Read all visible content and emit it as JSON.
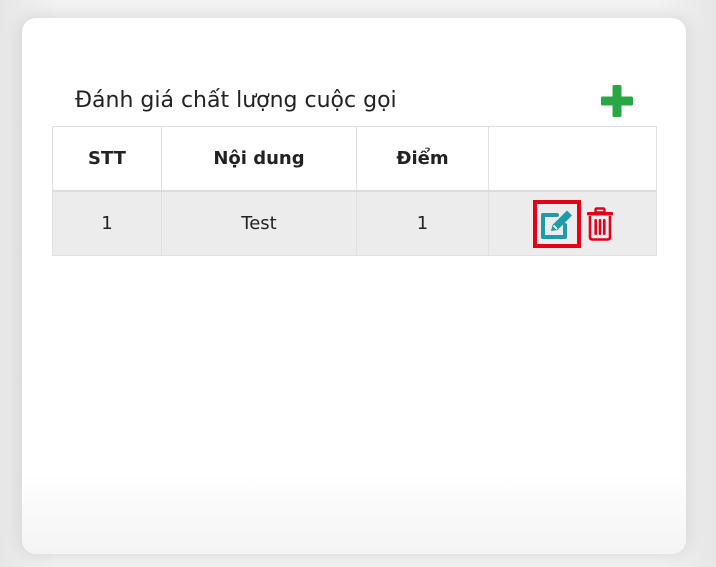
{
  "panel": {
    "title": "Đánh giá chất lượng cuộc gọi",
    "add_icon": "plus-icon",
    "add_color": "#28a745"
  },
  "table": {
    "columns": [
      "STT",
      "Nội dung",
      "Điểm",
      ""
    ],
    "rows": [
      {
        "stt": "1",
        "content": "Test",
        "score": "1",
        "actions": {
          "edit_icon": "edit-icon",
          "edit_color": "#1e9aa8",
          "edit_highlighted": true,
          "delete_icon": "trash-icon",
          "delete_color": "#e5001a"
        }
      }
    ]
  }
}
